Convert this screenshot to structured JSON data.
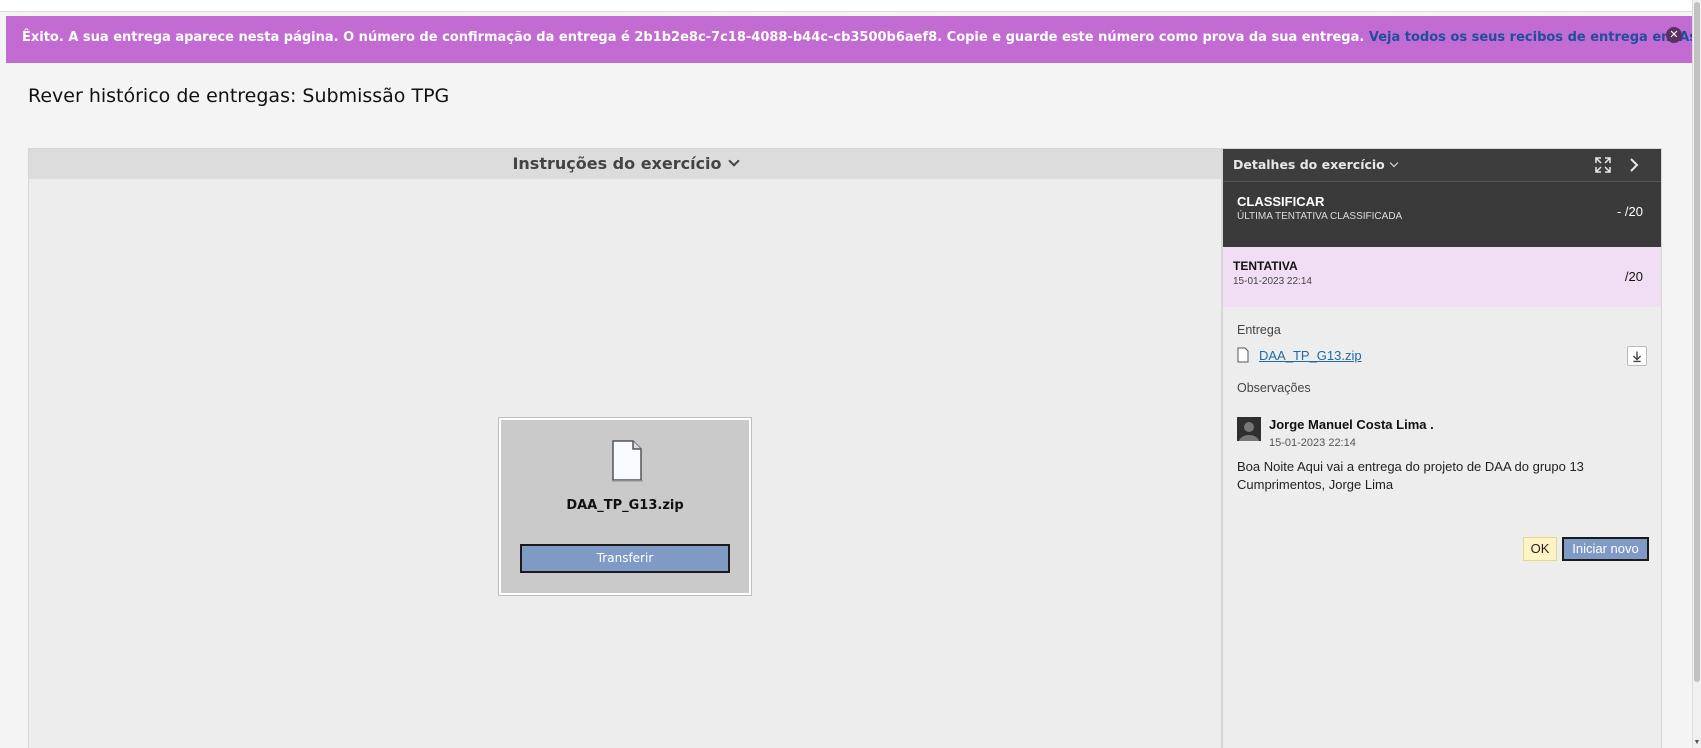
{
  "banner": {
    "message": "Êxito. A sua entrega aparece nesta página. O número de confirmação da entrega é 2b1b2e8c-7c18-4088-b44c-cb3500b6aef8. Copie e guarde este número como prova da sua entrega.",
    "link_text": "Veja todos os seus recibos de entrega em As minhas notas.",
    "close_glyph": "✕",
    "color": "#c26bd2"
  },
  "page": {
    "title": "Rever histórico de entregas: Submissão TPG"
  },
  "instructions": {
    "header": "Instruções do exercício"
  },
  "preview": {
    "file_name": "DAA_TP_G13.zip",
    "download_label": "Transferir"
  },
  "details": {
    "header": "Detalhes do exercício",
    "grade": {
      "title": "CLASSIFICAR",
      "subtitle": "ÚLTIMA TENTATIVA CLASSIFICADA",
      "value": "- /20"
    },
    "attempt": {
      "title": "TENTATIVA",
      "date": "15-01-2023 22:14",
      "value": "/20"
    },
    "submission_label": "Entrega",
    "submission_file": "DAA_TP_G13.zip",
    "comments_label": "Observações",
    "comment": {
      "user": "Jorge Manuel Costa Lima .",
      "date": "15-01-2023 22:14",
      "text_line1": "Boa Noite Aqui vai a entrega do projeto de DAA do grupo 13",
      "text_line2": "Cumprimentos, Jorge Lima"
    },
    "ok_label": "OK",
    "new_label": "Iniciar novo"
  }
}
